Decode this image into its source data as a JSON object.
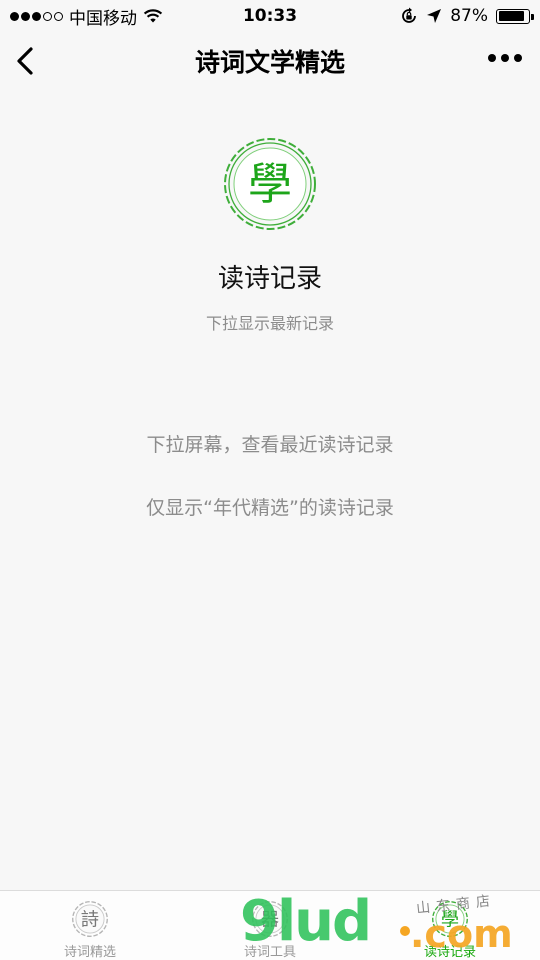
{
  "status_bar": {
    "carrier": "中国移动",
    "time": "10:33",
    "battery_percent": "87%",
    "battery_level": 0.87,
    "signal_filled": 3,
    "signal_total": 5,
    "icons": [
      "wifi-icon",
      "rotation-lock-icon",
      "location-arrow-icon",
      "battery-icon"
    ]
  },
  "nav": {
    "title": "诗词文学精选",
    "back_icon": "chevron-left-icon",
    "more_icon": "ellipsis-icon"
  },
  "main": {
    "seal_char": "學",
    "title": "读诗记录",
    "subtitle": "下拉显示最新记录",
    "hints": [
      "下拉屏幕，查看最近读诗记录",
      "仅显示“年代精选”的读诗记录"
    ]
  },
  "tabs": [
    {
      "label": "诗词精选",
      "icon_char": "詩",
      "active": false
    },
    {
      "label": "诗词工具",
      "icon_char": "器",
      "active": false
    },
    {
      "label": "读诗记录",
      "icon_char": "學",
      "active": true
    }
  ],
  "watermark": {
    "main": "9lud",
    "suffix": ".com",
    "small": "山东商店"
  },
  "colors": {
    "accent": "#19a90e",
    "hint_text": "#8c8c8c",
    "background": "#f7f7f7"
  }
}
